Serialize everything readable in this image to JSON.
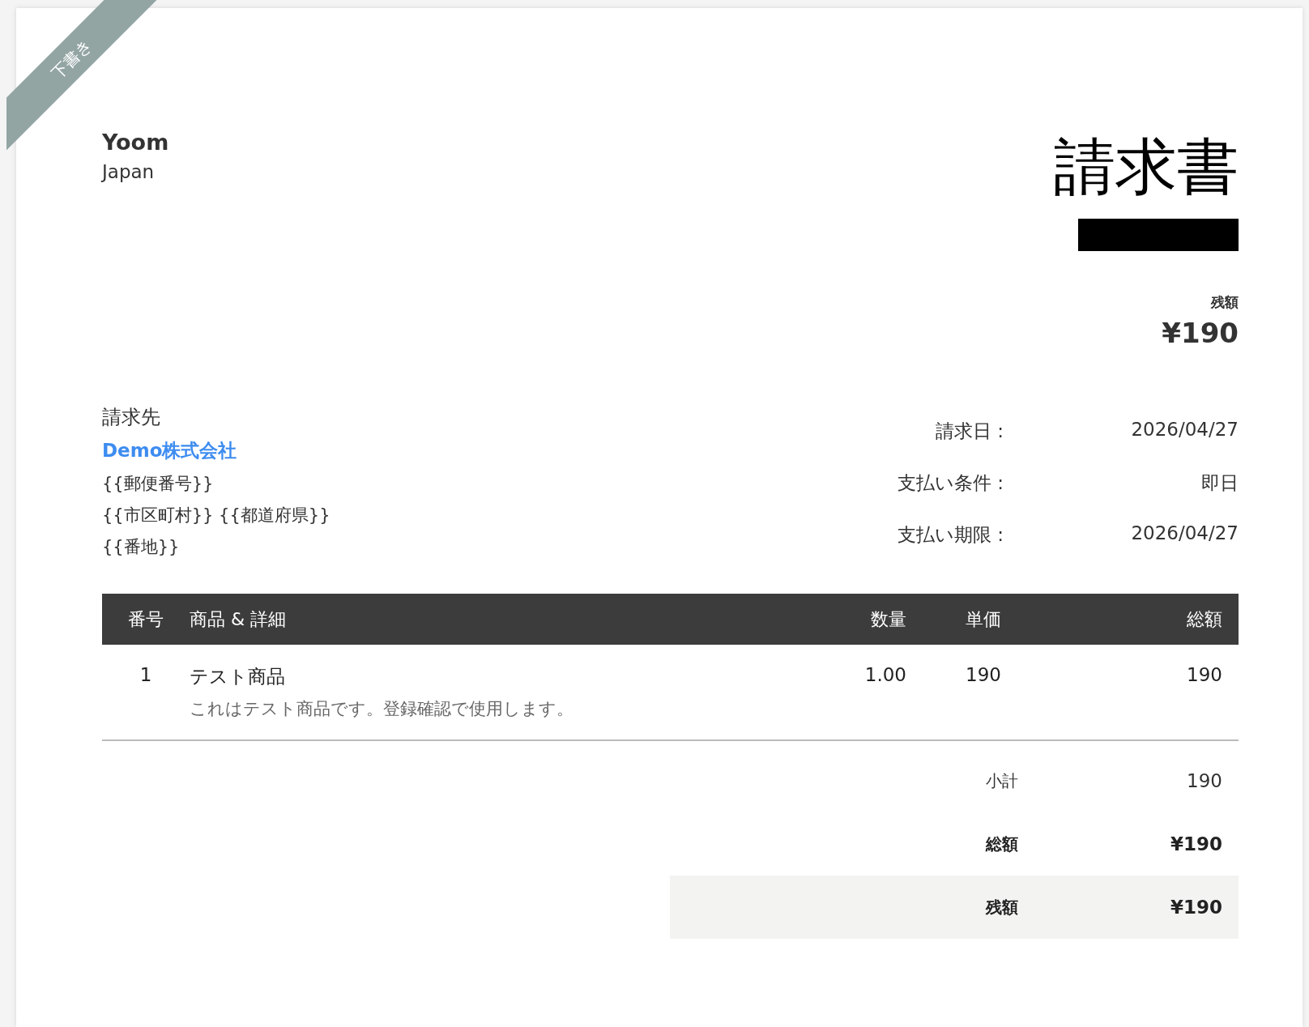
{
  "ribbon": {
    "label": "下書き"
  },
  "company": {
    "name": "Yoom",
    "country": "Japan"
  },
  "title": "請求書",
  "invoice_number": {
    "redacted": true
  },
  "balance": {
    "label": "残額",
    "amount": "¥190"
  },
  "bill_to": {
    "label": "請求先",
    "name": "Demo株式会社",
    "lines": [
      "{{郵便番号}}",
      "{{市区町村}} {{都道府県}}",
      "{{番地}}"
    ]
  },
  "meta": [
    {
      "label": "請求日 :",
      "value": "2026/04/27"
    },
    {
      "label": "支払い条件 :",
      "value": "即日"
    },
    {
      "label": "支払い期限 :",
      "value": "2026/04/27"
    }
  ],
  "table": {
    "columns": [
      "番号",
      "商品 & 詳細",
      "数量",
      "単価",
      "総額"
    ],
    "rows": [
      {
        "no": "1",
        "item": "テスト商品",
        "description": "これはテスト商品です。登録確認で使用します。",
        "qty": "1.00",
        "rate": "190",
        "amount": "190"
      }
    ]
  },
  "totals": [
    {
      "label": "小計",
      "value": "190",
      "kind": "plain"
    },
    {
      "label": "総額",
      "value": "¥190",
      "kind": "bold"
    },
    {
      "label": "残額",
      "value": "¥190",
      "kind": "highlight"
    }
  ]
}
